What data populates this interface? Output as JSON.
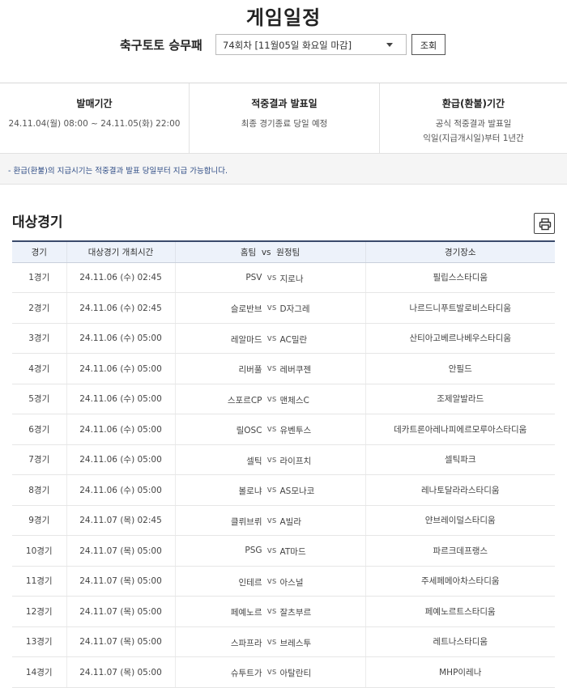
{
  "page": {
    "title": "게임일정",
    "game_label": "축구토토 승무패",
    "round_select_value": "74회차 [11월05일 화요일 마감]",
    "search_button": "조회"
  },
  "info": {
    "sale": {
      "heading": "발매기간",
      "text": "24.11.04(월) 08:00 ~ 24.11.05(화) 22:00"
    },
    "result": {
      "heading": "적중결과 발표일",
      "text": "최종 경기종료 당일 예정"
    },
    "refund": {
      "heading": "환급(환불)기간",
      "line1": "공식 적중결과 발표일",
      "line2": "익일(지급개시일)부터 1년간"
    }
  },
  "notice": "- 환급(환불)의 지급시기는 적중결과 발표 당일부터 지급 가능합니다.",
  "section": {
    "title": "대상경기"
  },
  "table": {
    "headers": {
      "game": "경기",
      "time": "대상경기 개최시간",
      "teams": "홈팀  vs  원정팀",
      "venue": "경기장소"
    },
    "rows": [
      {
        "game": "1경기",
        "time": "24.11.06 (수) 02:45",
        "home": "PSV",
        "vs": "vs",
        "away": "지로나",
        "venue": "필립스스타디움"
      },
      {
        "game": "2경기",
        "time": "24.11.06 (수) 02:45",
        "home": "슬로반브",
        "vs": "vs",
        "away": "D자그레",
        "venue": "나르드니푸트발로비스타디움"
      },
      {
        "game": "3경기",
        "time": "24.11.06 (수) 05:00",
        "home": "레알마드",
        "vs": "vs",
        "away": "AC밀란",
        "venue": "산티아고베르나베우스타디움"
      },
      {
        "game": "4경기",
        "time": "24.11.06 (수) 05:00",
        "home": "리버풀",
        "vs": "vs",
        "away": "레버쿠젠",
        "venue": "안필드"
      },
      {
        "game": "5경기",
        "time": "24.11.06 (수) 05:00",
        "home": "스포르CP",
        "vs": "vs",
        "away": "맨체스C",
        "venue": "조제알발라드"
      },
      {
        "game": "6경기",
        "time": "24.11.06 (수) 05:00",
        "home": "릴OSC",
        "vs": "vs",
        "away": "유벤투스",
        "venue": "데카트론아레나피에르모루아스타디움"
      },
      {
        "game": "7경기",
        "time": "24.11.06 (수) 05:00",
        "home": "셀틱",
        "vs": "vs",
        "away": "라이프치",
        "venue": "셀틱파크"
      },
      {
        "game": "8경기",
        "time": "24.11.06 (수) 05:00",
        "home": "볼로냐",
        "vs": "vs",
        "away": "AS모나코",
        "venue": "레나토달라라스타디움"
      },
      {
        "game": "9경기",
        "time": "24.11.07 (목) 02:45",
        "home": "클뤼브뤼",
        "vs": "vs",
        "away": "A빌라",
        "venue": "얀브레이덜스타디움"
      },
      {
        "game": "10경기",
        "time": "24.11.07 (목) 05:00",
        "home": "PSG",
        "vs": "vs",
        "away": "AT마드",
        "venue": "파르크데프랭스"
      },
      {
        "game": "11경기",
        "time": "24.11.07 (목) 05:00",
        "home": "인테르",
        "vs": "vs",
        "away": "아스널",
        "venue": "주세페메아차스타디움"
      },
      {
        "game": "12경기",
        "time": "24.11.07 (목) 05:00",
        "home": "페예노르",
        "vs": "vs",
        "away": "잘츠부르",
        "venue": "페예노르트스타디움"
      },
      {
        "game": "13경기",
        "time": "24.11.07 (목) 05:00",
        "home": "스파프라",
        "vs": "vs",
        "away": "브레스투",
        "venue": "레트나스타디움"
      },
      {
        "game": "14경기",
        "time": "24.11.07 (목) 05:00",
        "home": "슈투트가",
        "vs": "vs",
        "away": "아탈란티",
        "venue": "MHP이레나"
      }
    ]
  },
  "icons": {
    "select_caret": "chevron-down-icon",
    "print": "printer-icon"
  },
  "colors": {
    "header_bg": "#edf2fa",
    "header_top_border": "#3a4a6b",
    "notice_text": "#2f4d86",
    "notice_bg": "#f5f5f5"
  }
}
